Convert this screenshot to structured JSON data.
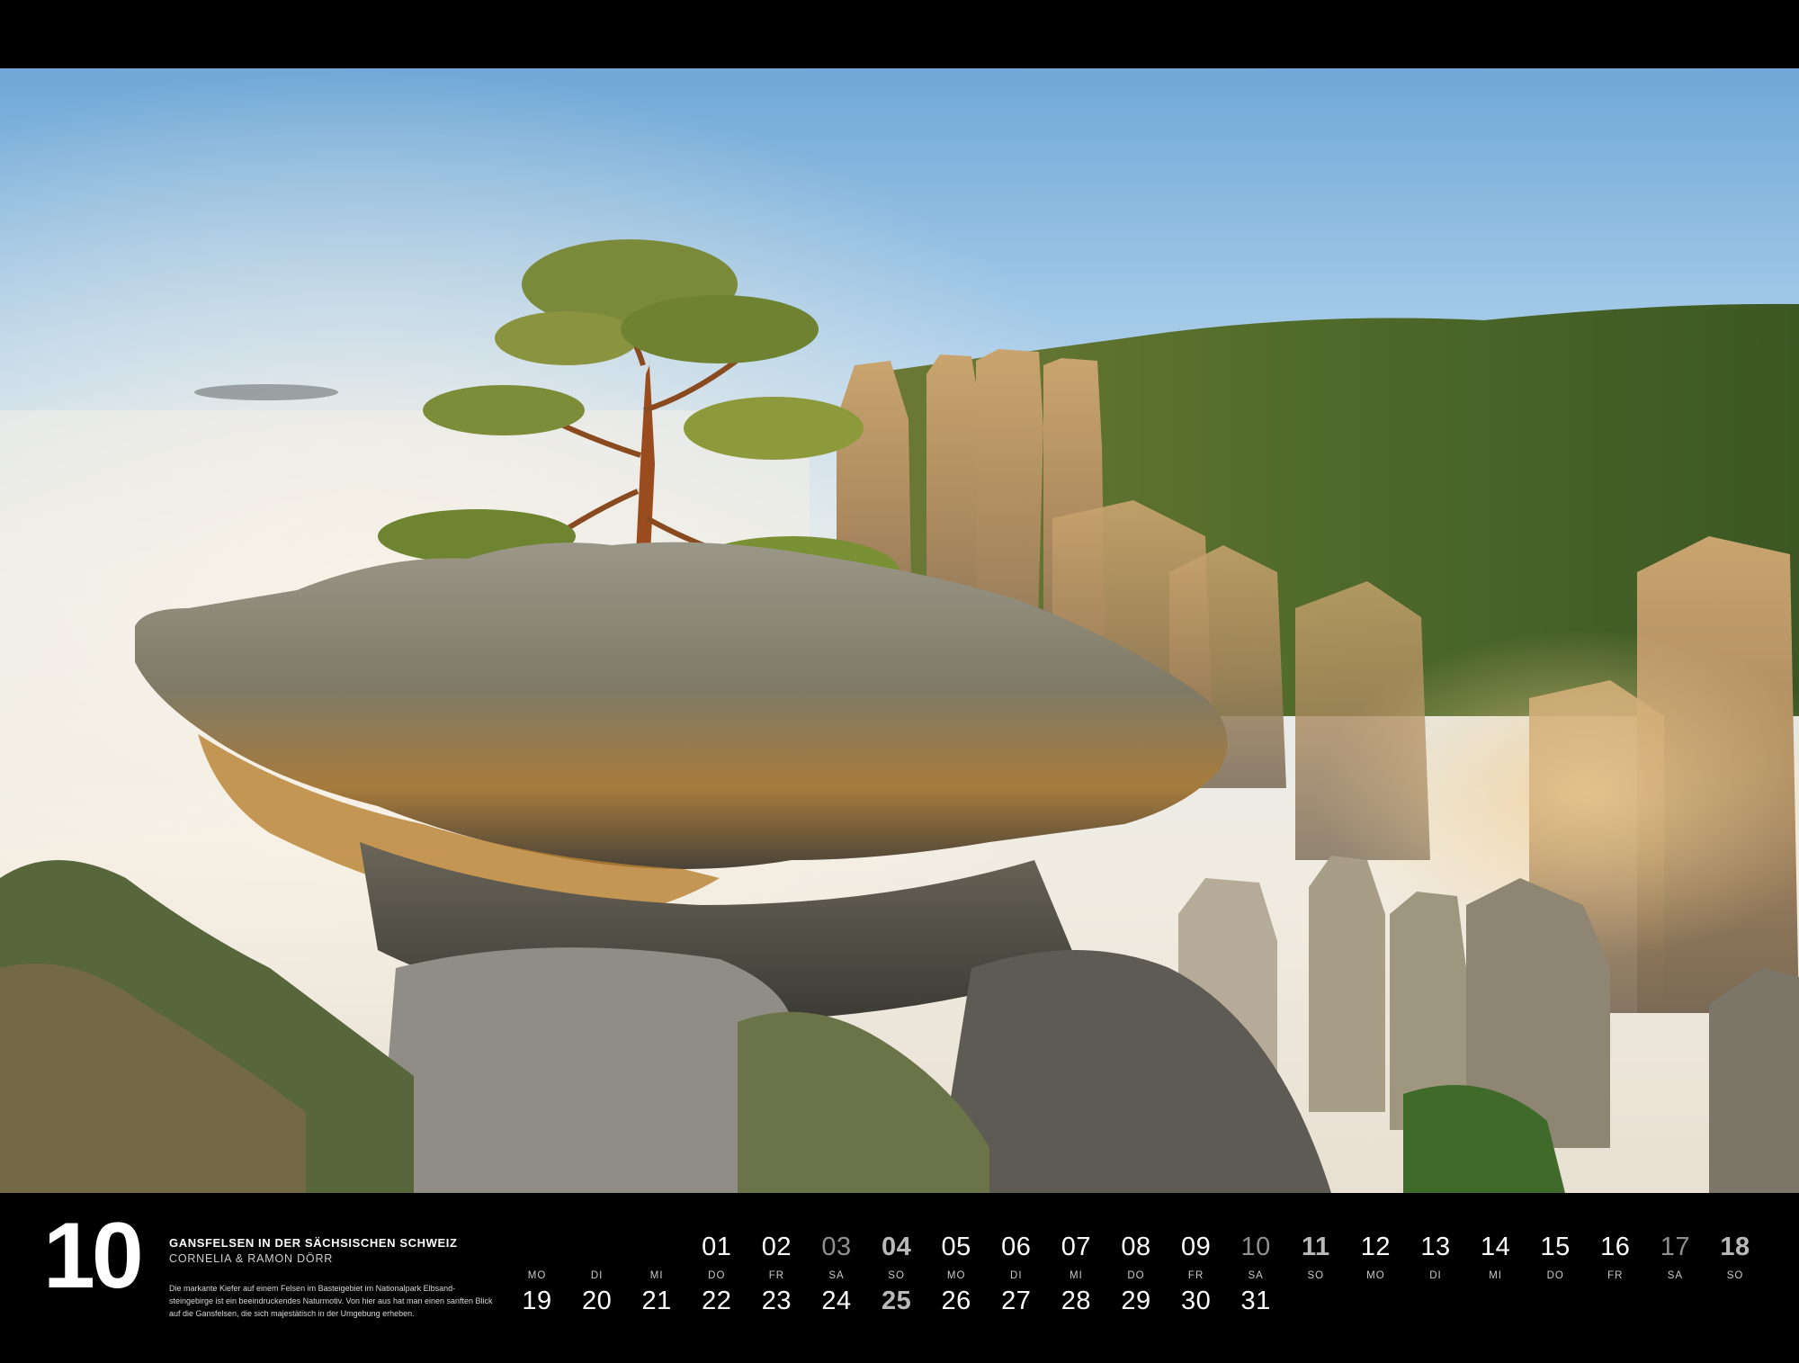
{
  "month": "10",
  "caption": {
    "title": "GANSFELSEN IN DER SÄCHSISCHEN SCHWEIZ",
    "author": "CORNELIA & RAMON DÖRR",
    "description": "Die markante Kiefer auf einem Felsen im Basteigebiet im Nationalpark Elbsand-steingebirge ist ein beeindruckendes Naturmotiv. Von hier aus hat man einen sanften Blick auf die Gansfelsen, die sich majestätisch in der Umgebung erheben."
  },
  "weekdays": [
    "MO",
    "DI",
    "MI",
    "DO",
    "FR",
    "SA",
    "SO",
    "MO",
    "DI",
    "MI",
    "DO",
    "FR",
    "SA",
    "SO",
    "MO",
    "DI",
    "MI",
    "DO",
    "FR",
    "SA",
    "SO"
  ],
  "row1": [
    "",
    "",
    "",
    "01",
    "02",
    "03",
    "04",
    "05",
    "06",
    "07",
    "08",
    "09",
    "10",
    "11",
    "12",
    "13",
    "14",
    "15",
    "16",
    "17",
    "18"
  ],
  "row2": [
    "19",
    "20",
    "21",
    "22",
    "23",
    "24",
    "25",
    "26",
    "27",
    "28",
    "29",
    "30",
    "31"
  ],
  "colors": {
    "background": "#000000",
    "text": "#ffffff",
    "sunday": "#b9b9b9",
    "saturday": "#8f8f8f"
  }
}
